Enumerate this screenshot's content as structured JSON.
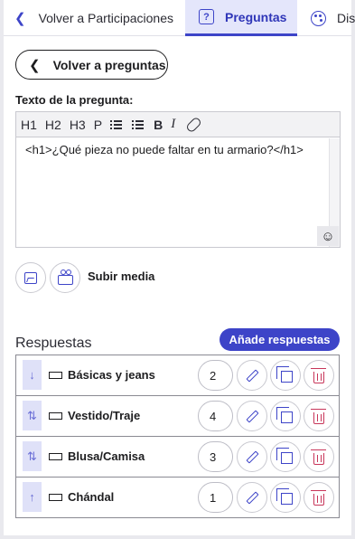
{
  "tabs": {
    "back_label": "Volver a Participaciones",
    "active_label": "Preguntas",
    "active_icon": "?",
    "next_label": "Dis"
  },
  "back_button": {
    "label": "Volver a preguntas"
  },
  "question": {
    "label": "Texto de la pregunta:",
    "toolbar": [
      "H1",
      "H2",
      "H3",
      "P",
      "B",
      "I"
    ],
    "text": "<h1>¿Qué pieza no puede faltar en tu armario?</h1>"
  },
  "media": {
    "label": "Subir media"
  },
  "answers": {
    "title": "Respuestas",
    "add_label": "Añade respuestas",
    "items": [
      {
        "arrow": "↓",
        "label": "Básicas y jeans",
        "value": "2"
      },
      {
        "arrow": "⇅",
        "label": "Vestido/Traje",
        "value": "4"
      },
      {
        "arrow": "⇅",
        "label": "Blusa/Camisa",
        "value": "3"
      },
      {
        "arrow": "↑",
        "label": "Chándal",
        "value": "1"
      }
    ]
  },
  "colors": {
    "accent": "#3d44c8",
    "danger": "#c8365a",
    "tab_active_bg": "#e4e6fb"
  }
}
